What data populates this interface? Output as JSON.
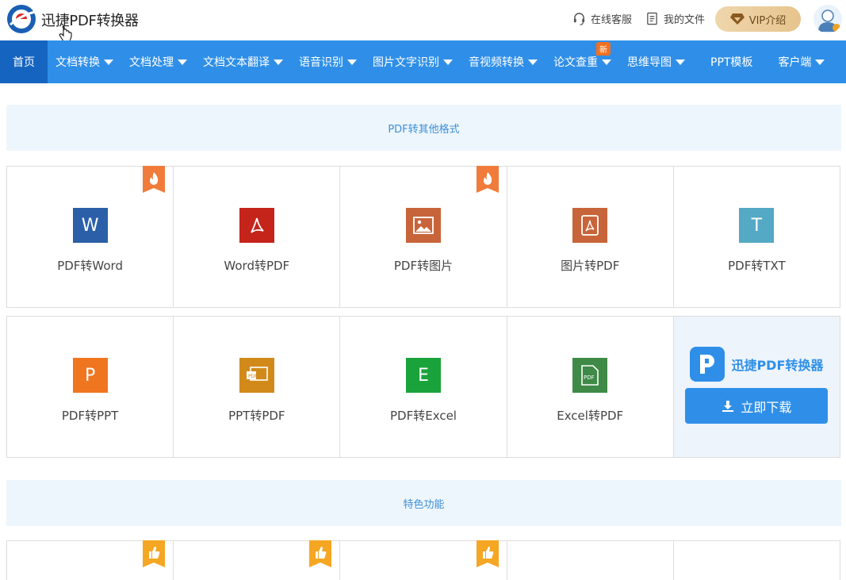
{
  "header": {
    "brand": "迅捷PDF转换器",
    "service_label": "在线客服",
    "files_label": "我的文件",
    "vip_label": "VIP介绍"
  },
  "nav": {
    "items": [
      {
        "label": "首页",
        "dropdown": false
      },
      {
        "label": "文档转换",
        "dropdown": true
      },
      {
        "label": "文档处理",
        "dropdown": true
      },
      {
        "label": "文档文本翻译",
        "dropdown": true
      },
      {
        "label": "语音识别",
        "dropdown": true
      },
      {
        "label": "图片文字识别",
        "dropdown": true
      },
      {
        "label": "音视频转换",
        "dropdown": true
      },
      {
        "label": "论文查重",
        "dropdown": true,
        "badge": "新"
      },
      {
        "label": "思维导图",
        "dropdown": true
      },
      {
        "label": "PPT模板",
        "dropdown": false
      },
      {
        "label": "客户端",
        "dropdown": true
      }
    ]
  },
  "sections": {
    "convert_title": "PDF转其他格式",
    "features_title": "特色功能"
  },
  "tools": {
    "row1": [
      {
        "label": "PDF转Word",
        "icon": "word-icon",
        "glyph": "W",
        "color": "#2b5fa8",
        "hot": true
      },
      {
        "label": "Word转PDF",
        "icon": "pdf-icon",
        "glyph": "",
        "color": "#c5241a",
        "hot": false
      },
      {
        "label": "PDF转图片",
        "icon": "image-icon",
        "glyph": "",
        "color": "#c8643a",
        "hot": true
      },
      {
        "label": "图片转PDF",
        "icon": "pdf-doc-icon",
        "glyph": "",
        "color": "#c8643a",
        "hot": false
      },
      {
        "label": "PDF转TXT",
        "icon": "txt-icon",
        "glyph": "T",
        "color": "#54a9c4",
        "hot": false
      }
    ],
    "row2": [
      {
        "label": "PDF转PPT",
        "icon": "ppt-icon",
        "glyph": "P",
        "color": "#f0751f"
      },
      {
        "label": "PPT转PDF",
        "icon": "ppt-to-pdf-icon",
        "glyph": "",
        "color": "#d18a1a"
      },
      {
        "label": "PDF转Excel",
        "icon": "excel-icon",
        "glyph": "E",
        "color": "#1aa33a"
      },
      {
        "label": "Excel转PDF",
        "icon": "excel-to-pdf-icon",
        "glyph": "",
        "color": "#3e8a46"
      }
    ]
  },
  "promo": {
    "title": "迅捷PDF转换器",
    "download_label": "立即下载"
  },
  "colors": {
    "nav_bg": "#2f8fe8",
    "nav_active": "#1565c0",
    "section_bg": "#eef6fd",
    "hot_ribbon": "#f07b3a",
    "like_ribbon": "#f5a623"
  }
}
